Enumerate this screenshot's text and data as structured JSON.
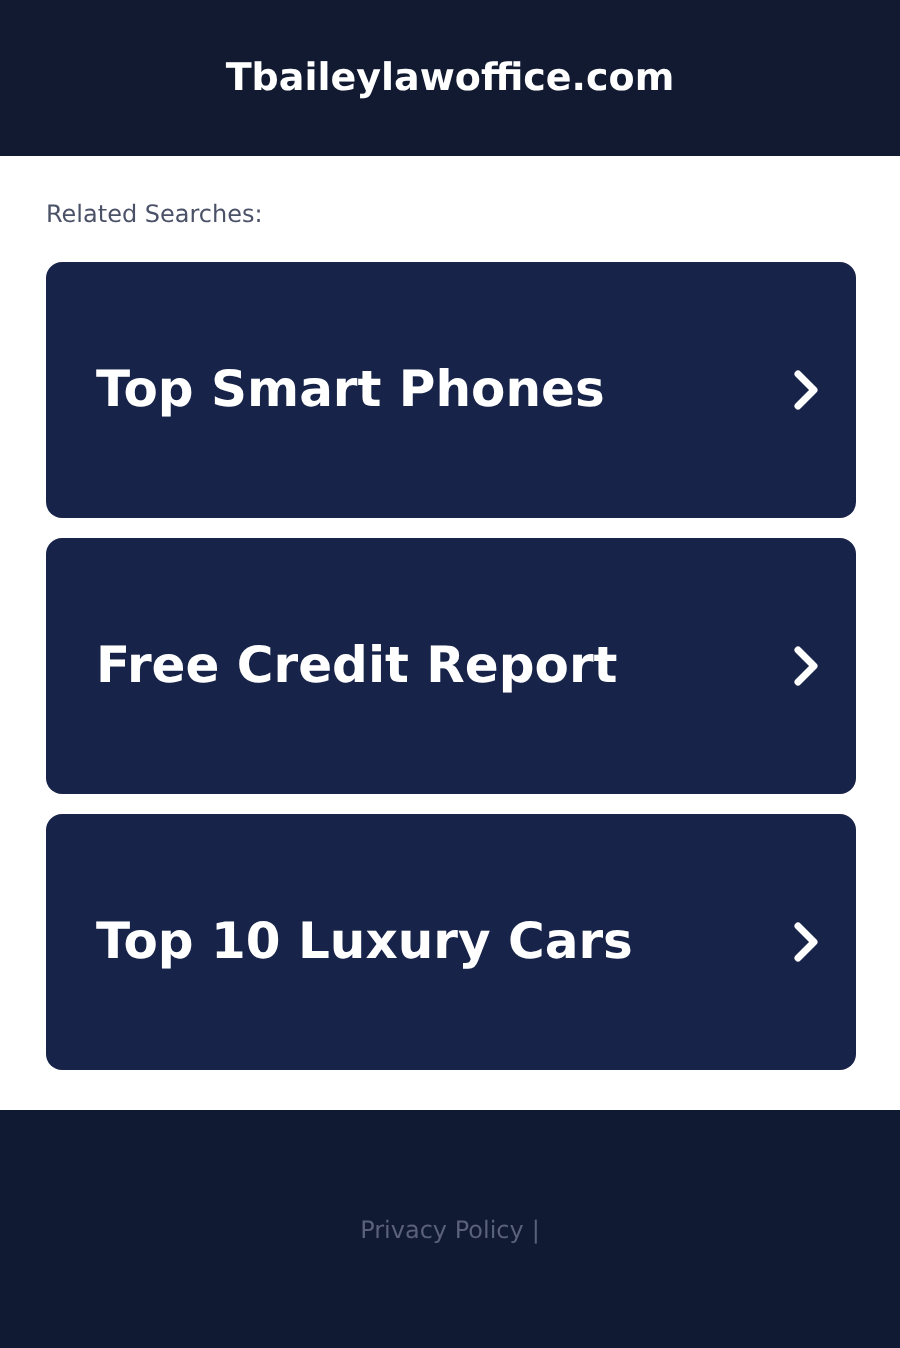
{
  "header": {
    "title": "Tbaileylawoffice.com"
  },
  "related": {
    "label": "Related Searches:",
    "items": [
      {
        "text": "Top Smart Phones"
      },
      {
        "text": "Free Credit Report"
      },
      {
        "text": "Top 10 Luxury Cars"
      }
    ]
  },
  "footer": {
    "links": [
      {
        "text": "Privacy Policy"
      }
    ],
    "separator": "|"
  }
}
